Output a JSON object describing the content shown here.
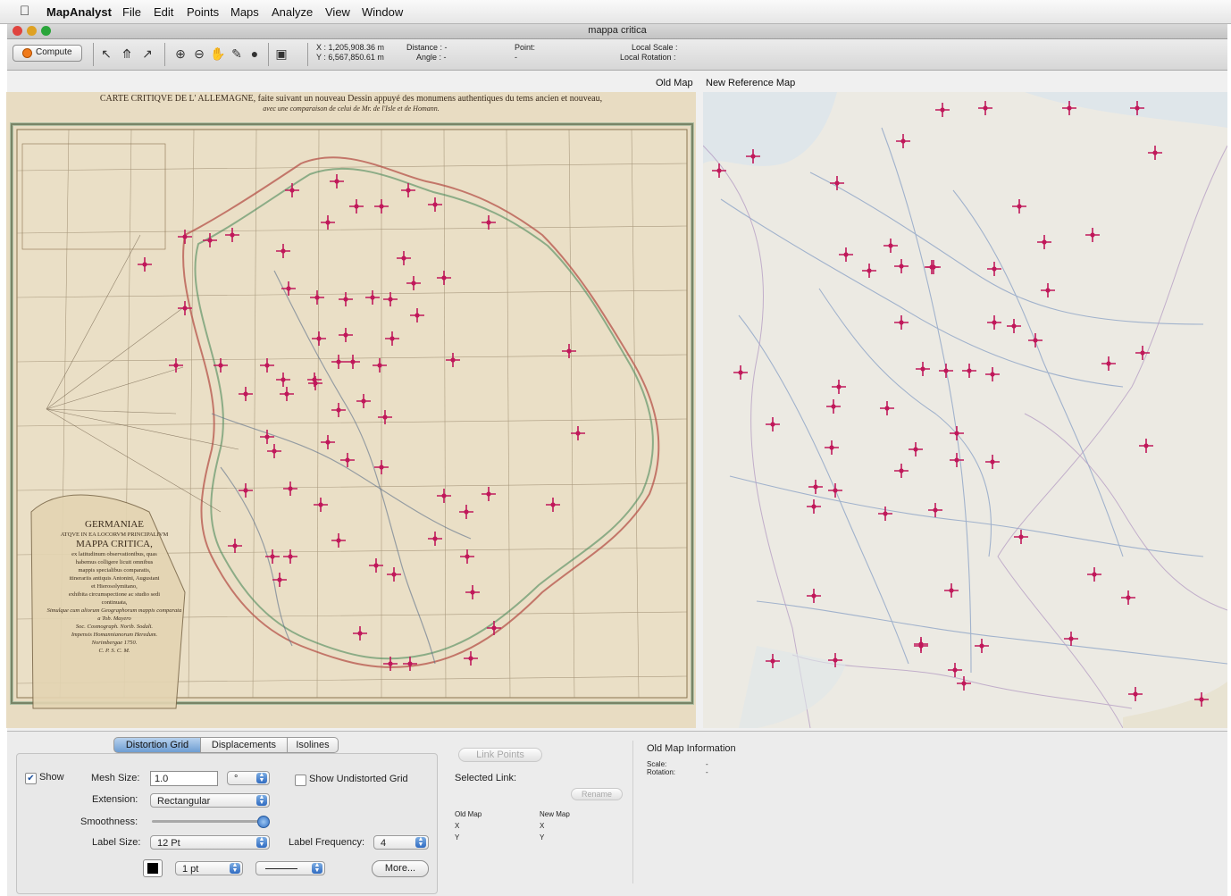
{
  "menubar": {
    "app_name": "MapAnalyst",
    "items": [
      "File",
      "Edit",
      "Points",
      "Maps",
      "Analyze",
      "View",
      "Window"
    ]
  },
  "window": {
    "title": "mappa critica"
  },
  "toolbar": {
    "compute_label": "Compute",
    "x_coord": "X : 1,205,908.36 m",
    "y_coord": "Y : 6,567,850.61 m",
    "distance_label": "Distance : -",
    "angle_label": "Angle : -",
    "point_label": "Point:",
    "point_value": "-",
    "local_scale_label": "Local Scale :",
    "local_rotation_label": "Local Rotation :"
  },
  "maps": {
    "old_header": "Old Map",
    "new_header": "New Reference Map",
    "old_title_line1": "CARTE CRITIQVE DE L' ALLEMAGNE, faite suivant un nouveau Dessin appuyé des monumens authentiques du tems ancien et nouveau,",
    "old_title_line2": "avec une comparaison de celui de Mr. de l'Isle et de Homann.",
    "cartouche": [
      "GERMANIAE",
      "ATQVE IN EA LOCORVM PRINCIPALIVM",
      "MAPPA CRITICA,",
      "ex latitudinum observationibus, quas",
      "habemus colligere licuit omnibus",
      "mappis specialibus comparatis,",
      "itinerariis antiquis Antonini, Augustani",
      "et Hierosolymitano,",
      "exhibita circumspectione ac studio sedi",
      "continuata,",
      "Simulque cum aliorum Geographorum mappis comparata",
      "a Tob. Mayero",
      "Soc. Cosmograph. Norib. Sodali.",
      "Impensis Homannianorum Heredum.",
      "Norimbergae 1750.",
      "C. P. S. C. M."
    ]
  },
  "bottom": {
    "tabs": [
      "Distortion Grid",
      "Displacements",
      "Isolines"
    ],
    "show_label": "Show",
    "mesh_size_label": "Mesh Size:",
    "mesh_size_value": "1.0",
    "mesh_unit": "°",
    "show_undistorted_label": "Show Undistorted Grid",
    "extension_label": "Extension:",
    "extension_value": "Rectangular",
    "smoothness_label": "Smoothness:",
    "label_size_label": "Label Size:",
    "label_size_value": "12 Pt",
    "label_frequency_label": "Label Frequency:",
    "label_frequency_value": "4",
    "line_width_value": "1 pt",
    "more_label": "More...",
    "link_points_label": "Link Points",
    "selected_link_label": "Selected Link:",
    "rename_label": "Rename",
    "old_map_col": "Old Map",
    "new_map_col": "New Map",
    "x_label": "X",
    "y_label": "Y",
    "old_map_info_title": "Old Map Information",
    "scale_label": "Scale:",
    "scale_value": "-",
    "rotation_label": "Rotation:",
    "rotation_value": "-"
  },
  "colors": {
    "marker": "#c0185a",
    "selected_tab": "#7aa6d8",
    "old_map_paper": "#e8dcc2",
    "new_map_base": "#eceae3"
  }
}
